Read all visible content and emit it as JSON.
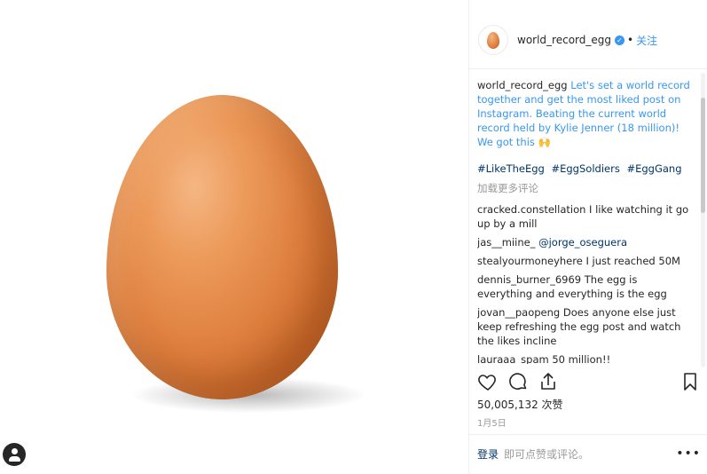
{
  "post": {
    "username": "world_record_egg",
    "separator": "•",
    "follow_label": "关注",
    "caption_user": "world_record_egg",
    "caption_text": "Let's set a world record together and get the most liked post on Instagram. Beating the current world record held by Kylie Jenner (18 million)! We got this 🙌",
    "hashtags": [
      "#LikeTheEgg",
      "#EggSoldiers",
      "#EggGang"
    ],
    "load_more": "加载更多评论",
    "comments": [
      {
        "user": "cracked.constellation",
        "text": "I like watching it go up by a mill"
      },
      {
        "user": "jas__miine_",
        "text": "@jorge_oseguera"
      },
      {
        "user": "stealyourmoneyhere",
        "text": "I just reached 50M"
      },
      {
        "user": "dennis_burner_6969",
        "text": "The egg is everything and everything is the egg"
      },
      {
        "user": "jovan__paopeng",
        "text": "Does anyone else just keep refreshing the egg post and watch the likes incline"
      },
      {
        "user": "lauraaa_spam",
        "text": "50 million!!"
      }
    ],
    "likes": "50,005,132 次赞",
    "date": "1月5日",
    "login_label": "登录",
    "login_hint": "即可点赞或评论。",
    "more_icon": "more-options-icon"
  },
  "icons": [
    "heart-icon",
    "comment-icon",
    "share-icon",
    "bookmark-icon",
    "verified-badge-icon",
    "profile-icon"
  ],
  "colors": {
    "link": "#3897f0",
    "hashtag": "#003569",
    "muted": "#999999",
    "egg": "#de7f3e"
  }
}
